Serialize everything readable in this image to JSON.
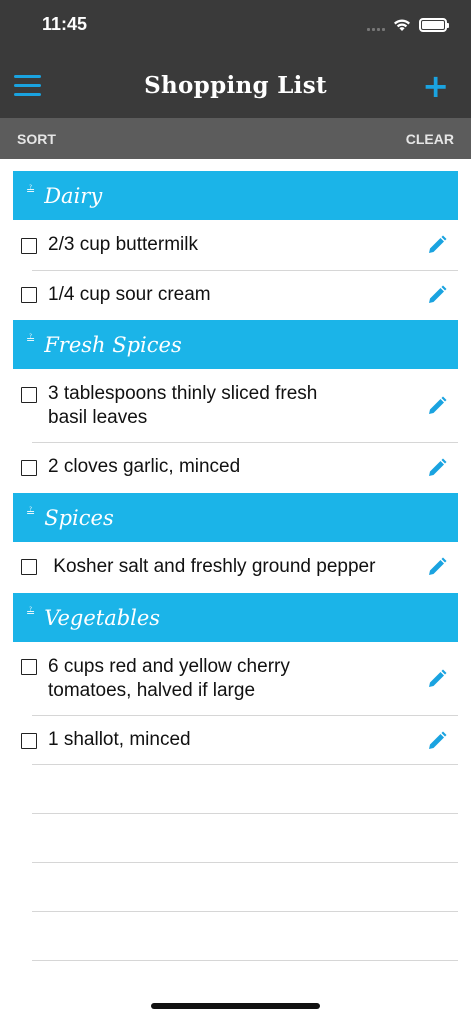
{
  "status_bar": {
    "time": "11:45"
  },
  "nav": {
    "title": "Shopping List",
    "add_label": "+"
  },
  "toolbar": {
    "sort_label": "SORT",
    "clear_label": "CLEAR"
  },
  "sections": [
    {
      "name": "Dairy",
      "items": [
        "2/3 cup buttermilk",
        "1/4 cup sour cream"
      ]
    },
    {
      "name": "Fresh Spices",
      "items": [
        "3 tablespoons thinly sliced fresh basil leaves",
        "2 cloves garlic, minced"
      ]
    },
    {
      "name": "Spices",
      "items": [
        " Kosher salt and freshly ground pepper"
      ]
    },
    {
      "name": "Vegetables",
      "items": [
        "6 cups red and yellow cherry tomatoes, halved if large",
        "1 shallot, minced"
      ]
    }
  ],
  "colors": {
    "accent": "#1bb4e8",
    "header_bg": "#3a3a3a",
    "toolbar_bg": "#5c5c5c"
  }
}
